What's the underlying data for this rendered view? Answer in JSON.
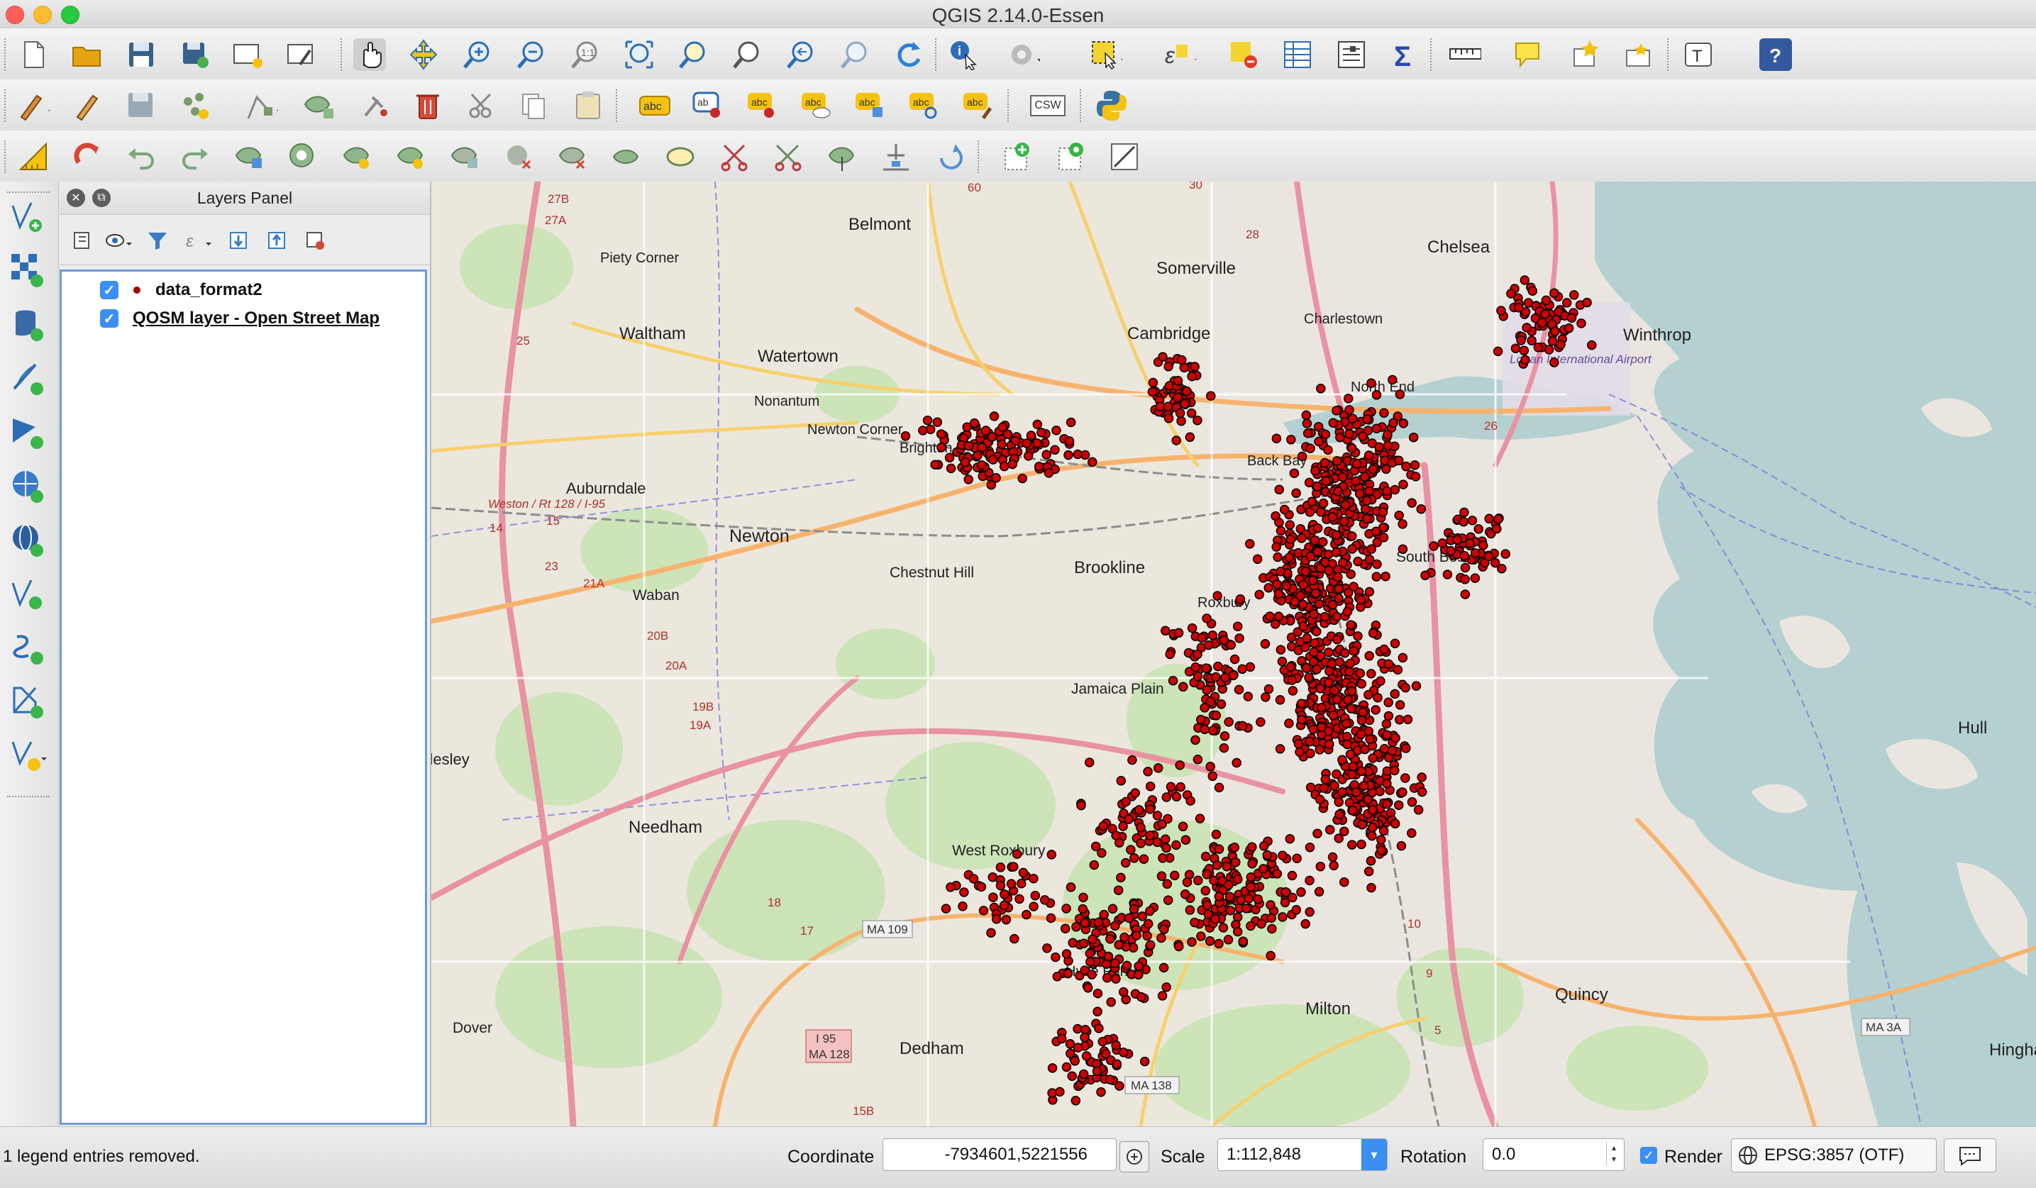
{
  "window": {
    "title": "QGIS 2.14.0-Essen"
  },
  "toolbar": {
    "row1": [
      "new-project-icon",
      "open-project-icon",
      "save-project-icon",
      "save-as-icon",
      "new-print-composer-icon",
      "composer-manager-icon",
      "pan-icon",
      "pan-to-selection-icon",
      "zoom-in-icon",
      "zoom-out-icon",
      "zoom-native-icon",
      "zoom-full-icon",
      "zoom-to-selection-icon",
      "zoom-to-layer-icon",
      "zoom-last-icon",
      "zoom-next-icon",
      "refresh-icon",
      "identify-icon",
      "run-action-icon",
      "select-features-icon",
      "select-by-expression-icon",
      "deselect-icon",
      "attribute-table-icon",
      "field-calculator-icon",
      "statistics-icon",
      "measure-icon",
      "map-tips-icon",
      "new-bookmark-icon",
      "show-bookmarks-icon",
      "text-annotation-icon",
      "help-icon"
    ],
    "row2": [
      "current-edits-icon",
      "toggle-editing-icon",
      "save-edits-icon",
      "add-feature-icon",
      "move-feature-icon",
      "node-tool-icon",
      "delete-selected-icon",
      "cut-features-icon",
      "copy-features-icon",
      "paste-features-icon",
      "label-icon",
      "pin-labels-icon",
      "highlight-pinned-icon",
      "show-hide-labels-icon",
      "move-label-icon",
      "rotate-label-icon",
      "change-label-icon",
      "csw-icon",
      "python-console-icon"
    ],
    "row3": [
      "digitizing-icon",
      "snapping-icon",
      "undo-icon",
      "redo-icon",
      "simplify-icon",
      "add-ring-icon",
      "add-part-icon",
      "fill-ring-icon",
      "delete-ring-icon",
      "delete-part-icon",
      "reshape-icon",
      "offset-curve-icon",
      "split-features-icon",
      "split-parts-icon",
      "merge-features-icon",
      "merge-attributes-icon",
      "rotate-symbols-icon",
      "rotate-feature-icon",
      "add-point-green-icon",
      "add-point-layer-icon",
      "measure-angle-icon"
    ],
    "csw_label": "CSW"
  },
  "left_toolbar": [
    "add-vector-layer-icon",
    "add-raster-layer-icon",
    "add-postgis-layer-icon",
    "add-spatialite-layer-icon",
    "add-mssql-layer-icon",
    "add-wms-layer-icon",
    "add-wcs-layer-icon",
    "add-wfs-layer-icon",
    "add-delimited-text-icon",
    "add-virtual-layer-icon",
    "new-shapefile-icon"
  ],
  "layers_panel": {
    "title": "Layers Panel",
    "layers": [
      {
        "name": "data_format2",
        "checked": true,
        "symbol": "red-dot"
      },
      {
        "name": "QOSM layer - Open Street Map",
        "checked": true,
        "symbol": "none"
      }
    ]
  },
  "map": {
    "places": [
      "Belmont",
      "Piety Corner",
      "Somerville",
      "Chelsea",
      "Winthrop",
      "Waltham",
      "Watertown",
      "Cambridge",
      "Logan International Airport",
      "Charlestown",
      "North End",
      "Nonantum",
      "Newton Corner",
      "Brighton",
      "Auburndale",
      "Weston / Rt 128 / I-95",
      "Newton",
      "Chestnut Hill",
      "Brookline",
      "South Boston",
      "Back Bay",
      "Waban",
      "Roxbury",
      "Jamaica Plain",
      "Wellesley",
      "Needham",
      "West Roxbury",
      "Hyde Park",
      "Milton",
      "Quincy",
      "Hull",
      "Dover",
      "Dedham",
      "Hingham"
    ],
    "shields": [
      "MA 109",
      "I 95",
      "MA 128",
      "MA 138",
      "MA 3A",
      "26",
      "27A",
      "27B",
      "30",
      "28",
      "60",
      "14",
      "15",
      "21A",
      "20B",
      "20A",
      "19B",
      "19A",
      "17",
      "18",
      "10",
      "9",
      "5",
      "15B",
      "23",
      "25"
    ],
    "layer_point_color": "#cc0000",
    "water_color": "#b5d0d0",
    "land_color": "#eae6df"
  },
  "status_bar": {
    "message": "1 legend entries removed.",
    "coordinate_label": "Coordinate",
    "coordinate_value": "-7934601,5221556",
    "scale_label": "Scale",
    "scale_value": "1:112,848",
    "rotation_label": "Rotation",
    "rotation_value": "0.0",
    "render_label": "Render",
    "render_checked": true,
    "crs": "EPSG:3857 (OTF)"
  }
}
